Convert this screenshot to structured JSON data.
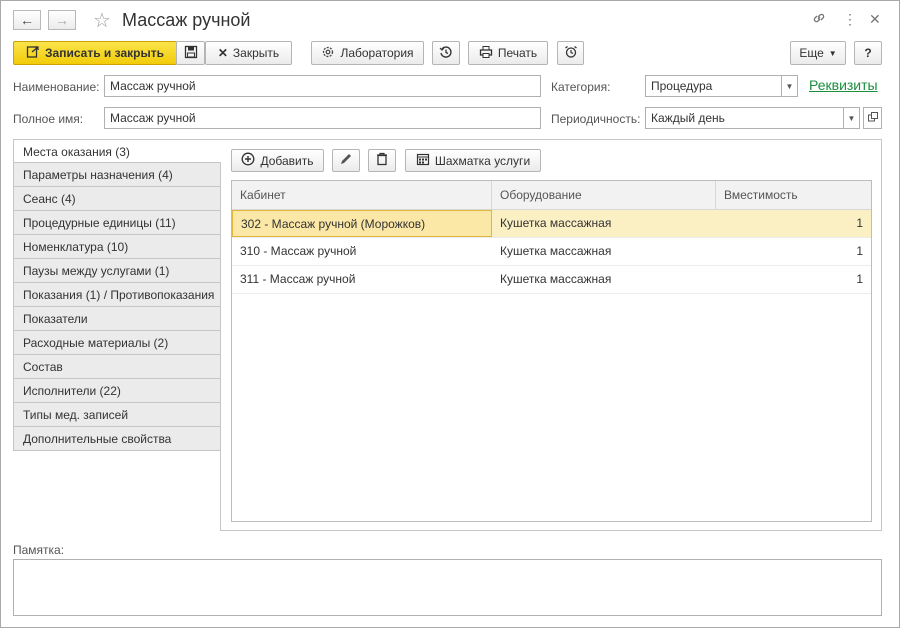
{
  "window": {
    "title": "Массаж ручной"
  },
  "toolbar": {
    "save_close": "Записать и закрыть",
    "close": "Закрыть",
    "lab": "Лаборатория",
    "print": "Печать",
    "more": "Еще",
    "help": "?"
  },
  "form": {
    "name_label": "Наименование:",
    "name_value": "Массаж ручной",
    "fullname_label": "Полное имя:",
    "fullname_value": "Массаж ручной",
    "category_label": "Категория:",
    "category_value": "Процедура",
    "periodicity_label": "Периодичность:",
    "periodicity_value": "Каждый день",
    "requisites_link": "Реквизиты"
  },
  "tabs": [
    {
      "label": "Места оказания (3)",
      "active": true
    },
    {
      "label": "Параметры назначения (4)"
    },
    {
      "label": "Сеанс (4)"
    },
    {
      "label": "Процедурные единицы (11)"
    },
    {
      "label": "Номенклатура (10)"
    },
    {
      "label": "Паузы между услугами (1)"
    },
    {
      "label": "Показания (1) / Противопоказания"
    },
    {
      "label": "Показатели"
    },
    {
      "label": "Расходные материалы (2)"
    },
    {
      "label": "Состав"
    },
    {
      "label": "Исполнители (22)"
    },
    {
      "label": "Типы мед. записей"
    },
    {
      "label": "Дополнительные свойства"
    }
  ],
  "panel": {
    "add_label": "Добавить",
    "chess_label": "Шахматка услуги"
  },
  "table": {
    "columns": [
      "Кабинет",
      "Оборудование",
      "Вместимость"
    ],
    "rows": [
      {
        "cabinet": "302 - Массаж ручной (Морожков)",
        "equipment": "Кушетка массажная",
        "capacity": "1"
      },
      {
        "cabinet": "310 - Массаж ручной",
        "equipment": "Кушетка массажная",
        "capacity": "1"
      },
      {
        "cabinet": "311 - Массаж ручной",
        "equipment": "Кушетка массажная",
        "capacity": "1"
      }
    ]
  },
  "memo": {
    "label": "Памятка:",
    "value": ""
  },
  "colors": {
    "primary_button": "#f2cc0a",
    "link": "#1a8f3c",
    "selected_row": "#fbf0c4"
  }
}
